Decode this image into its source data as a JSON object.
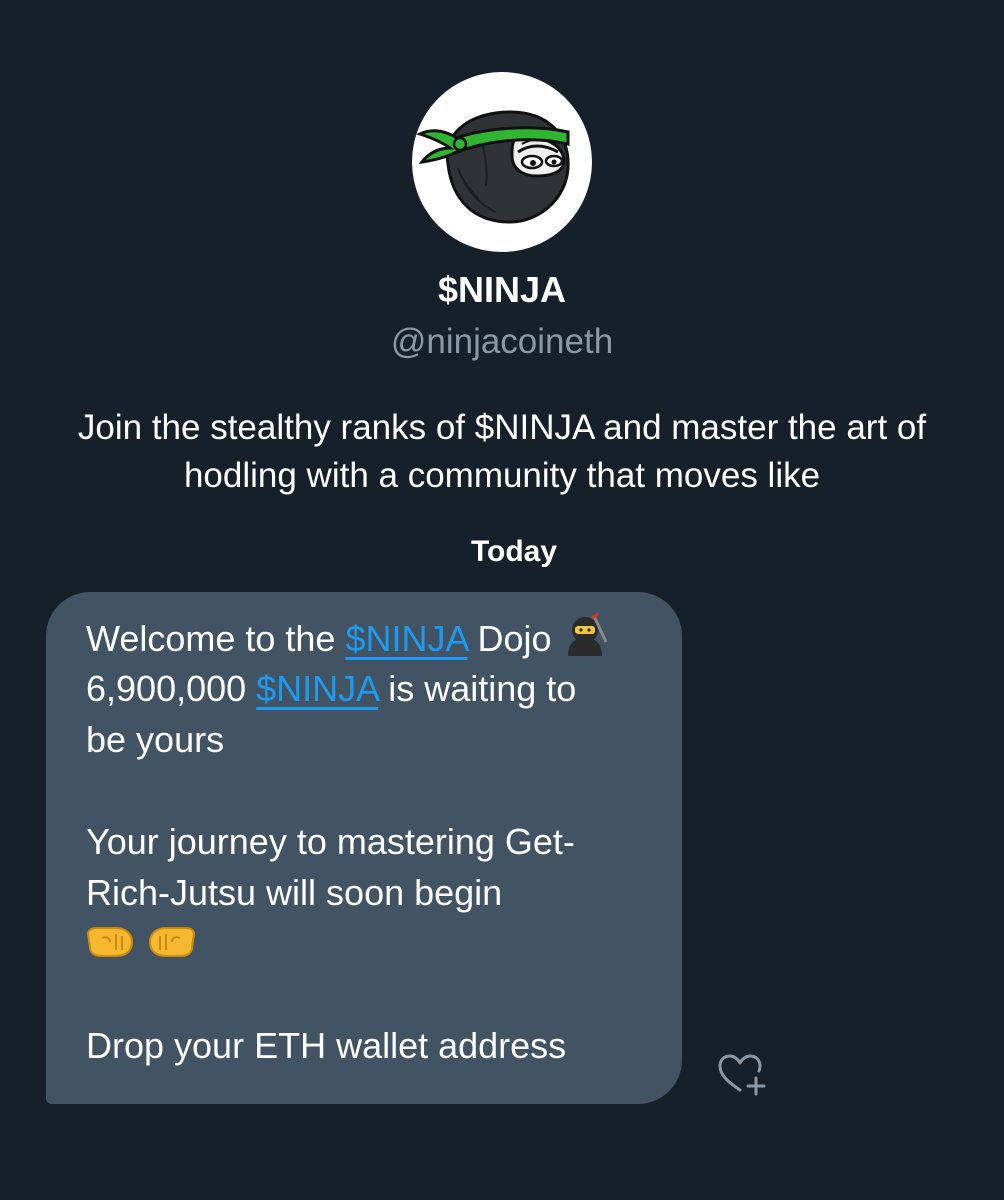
{
  "profile": {
    "display_name": "$NINJA",
    "handle": "@ninjacoineth",
    "bio": "Join the stealthy ranks of $NINJA and master the art of hodling with a community that moves like",
    "avatar": "ninja-mascot-avatar"
  },
  "conversation": {
    "date_separator": "Today"
  },
  "message": {
    "line1_prefix": "Welcome to the ",
    "line1_link": "$NINJA",
    "line1_suffix": " Dojo",
    "line1_emoji": "🥷",
    "line2_prefix": "6,900,000 ",
    "line2_link": "$NINJA",
    "line2_suffix": " is waiting to",
    "line3": "be yours",
    "line4": "Your journey to mastering Get-",
    "line5": "Rich-Jutsu will soon begin",
    "line6_emojis": "🤜🤛",
    "line7": "Drop your ETH wallet address"
  },
  "actions": {
    "react_icon": "heart-plus-icon"
  },
  "colors": {
    "background": "#15202b",
    "bubble": "#425364",
    "link": "#1d9bf0",
    "secondary_text": "#8b98a5",
    "headband": "#2fb52f"
  }
}
